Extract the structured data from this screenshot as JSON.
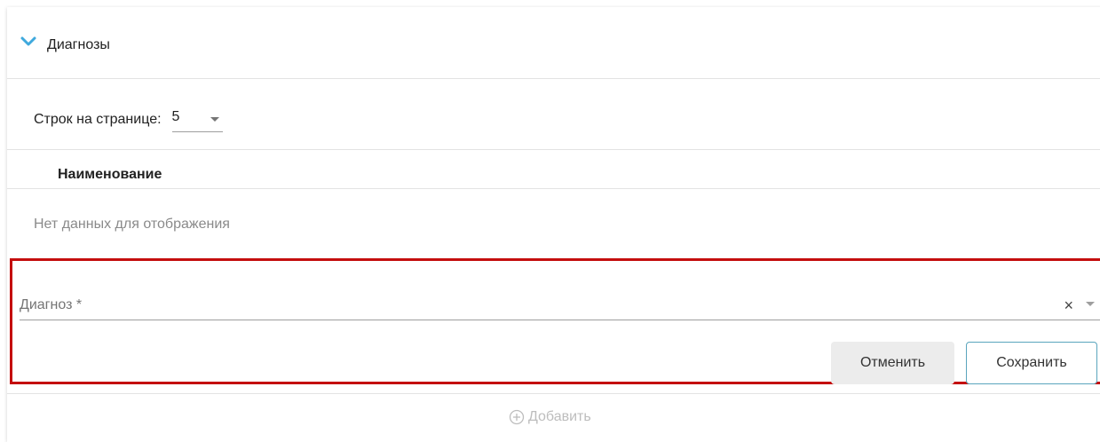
{
  "section": {
    "title": "Диагнозы",
    "expanded": true
  },
  "pagination": {
    "rows_label": "Строк на странице:",
    "rows_value": "5"
  },
  "table": {
    "columns": [
      "Наименование"
    ],
    "empty_text": "Нет данных для отображения"
  },
  "form": {
    "diagnosis_label": "Диагноз *",
    "diagnosis_value": "",
    "clear_icon": "×",
    "cancel_label": "Отменить",
    "save_label": "Сохранить",
    "highlight_color": "#c40d0d"
  },
  "add": {
    "label": "Добавить"
  },
  "colors": {
    "accent": "#3fa9dd",
    "save_border": "#5aa5bd",
    "disabled": "#bdbdbd"
  },
  "icons": {
    "section_toggle": "chevron-down-icon",
    "clear": "close-icon",
    "dropdown": "caret-down-icon",
    "add": "plus-circle-icon"
  }
}
